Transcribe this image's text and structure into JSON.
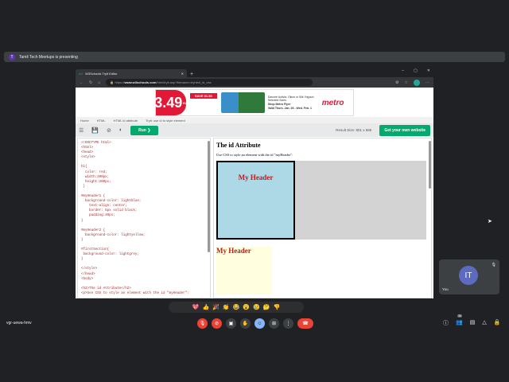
{
  "meet": {
    "presenting": "Tamil Tech Meetups is presenting",
    "presenter_initial": "T",
    "meeting_code": "vgr-uewa-hmv",
    "self_initials": "IT",
    "self_label": "You",
    "participant_count": "36",
    "reactions": [
      "💖",
      "👍",
      "🎉",
      "👏",
      "😂",
      "😮",
      "😢",
      "🤔",
      "👎"
    ]
  },
  "browser": {
    "tab_title": "W3Schools Tryit Editor",
    "url_prefix": "https://",
    "url_domain": "www.w3schools.com",
    "url_path": "/html/tryit.asp?filename=tryhtml_id_css"
  },
  "ad": {
    "price": "3.49",
    "unit": "EA",
    "save": "SAVE $1.50",
    "text": "Danone Activia, Oikos or Silk Yogourt, Selected Sizes.",
    "cta": "Shop Metro Flyer",
    "valid": "Valid Thurs. Jan. 26 - Wed. Feb. 1",
    "brand": "metro"
  },
  "breadcrumb": [
    "Home",
    "HTML",
    "HTML id attribute",
    "Tryit: use id to style element"
  ],
  "toolbar": {
    "run": "Run ❯",
    "result_size": "Result Size: 801 x 586",
    "get_website": "Get your own website"
  },
  "code": "<!DOCTYPE html>\n<html>\n<head>\n<style>\n\nh1{\n  color: red;\n  width:200px;\n  height:200px;\n }\n\n#myHeader1 {\n  background-color: lightblue;\n    text-align: center;\n    border: 5px solid black;\n    padding:40px;\n}\n\n#myHeader2 {\n  background-color: lightyellow;\n}\n\n#firstSection{\n background-color: lightgrey;\n}\n\n</style>\n</head>\n<body>\n\n<h2>The id Attribute</h2>\n<p>Use CSS to style an element with the id \"myHeader\":",
  "result": {
    "heading": "The id Attribute",
    "paragraph": "Use CSS to style an element with the id \"myHeader\":",
    "header1": "My Header",
    "header2": "My Header"
  }
}
